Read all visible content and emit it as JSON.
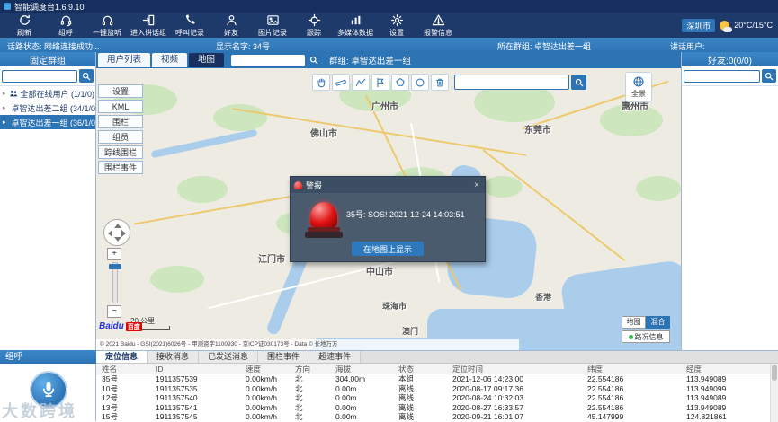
{
  "window": {
    "title": "智能调度台1.6.9.10"
  },
  "toolbar": {
    "buttons": [
      "刷新",
      "组呼",
      "一键监听",
      "进入讲话组",
      "呼叫记录",
      "好友",
      "图片记录",
      "跟踪",
      "多媒体数据",
      "设置",
      "报警信息"
    ],
    "city": "深圳市",
    "temperature": "20°C/15°C"
  },
  "status_bar": {
    "line_status": "话路状态: 网络连接成功...",
    "display_name": "显示名字: 34号",
    "current_group": "所在群组: 卓智达出差一组",
    "talking_user": "讲话用户:"
  },
  "fixed_groups": {
    "title": "固定群组",
    "items": [
      {
        "label": "全部在线用户 (1/1/0)",
        "selected": false
      },
      {
        "label": "卓智达出差二组 (34/1/0)",
        "selected": false
      },
      {
        "label": "卓智达出差一组 (36/1/0)",
        "selected": true
      }
    ]
  },
  "group_call": {
    "title": "组呼"
  },
  "watermark": "大数跨境",
  "center_tabs": {
    "items": [
      "用户列表",
      "视频",
      "地图"
    ],
    "active": "地图",
    "group_info": "群组: 卓智达出差一组"
  },
  "map": {
    "menu": [
      "设置",
      "KML",
      "围栏",
      "组员",
      "踪线围栏",
      "围栏事件"
    ],
    "panorama": "全景",
    "scale": "20 公里",
    "copyright": "© 2021 Baidu - GSI(2021)6026号 - 甲测资字1100930 - 京ICP证030173号 - Data © 长地万方",
    "logo": "Baidu",
    "logo_cn": "百度",
    "layer_map": "地图",
    "layer_hybrid": "混合",
    "traffic": "路况信息",
    "cities": [
      "广州市",
      "惠州市",
      "佛山市",
      "东莞市",
      "江门市",
      "中山市",
      "珠海市",
      "澳门",
      "香港"
    ]
  },
  "alarm_dialog": {
    "title": "警报",
    "message": "35号: SOS!  2021-12-24 14:03:51",
    "action": "在地图上显示"
  },
  "friends": {
    "title": "好友:0(0/0)"
  },
  "bottom": {
    "tabs": [
      "定位信息",
      "接收消息",
      "已发送消息",
      "围栏事件",
      "超速事件"
    ],
    "active_tab": "定位信息",
    "headers": [
      "姓名",
      "ID",
      "速度",
      "方向",
      "海拔",
      "状态",
      "定位时间",
      "纬度",
      "经度"
    ],
    "rows": [
      [
        "35号",
        "1911357539",
        "0.00km/h",
        "北",
        "304.00m",
        "本组",
        "2021-12-06 14:23:00",
        "22.554186",
        "113.949089"
      ],
      [
        "10号",
        "1911357535",
        "0.00km/h",
        "北",
        "0.00m",
        "离线",
        "2020-08-17 09:17:36",
        "22.554186",
        "113.949099"
      ],
      [
        "12号",
        "1911357540",
        "0.00km/h",
        "北",
        "0.00m",
        "离线",
        "2020-08-24 10:32:03",
        "22.554186",
        "113.949089"
      ],
      [
        "13号",
        "1911357541",
        "0.00km/h",
        "北",
        "0.00m",
        "离线",
        "2020-08-27 16:33:57",
        "22.554186",
        "113.949089"
      ],
      [
        "15号",
        "1911357545",
        "0.00km/h",
        "北",
        "0.00m",
        "离线",
        "2020-09-21 16:01:07",
        "45.147999",
        "124.821861"
      ]
    ]
  },
  "icons": {
    "search": "magnifier",
    "refresh": "circular-arrow",
    "alarm": "warning-triangle",
    "mic": "microphone",
    "siren": "red-beacon",
    "weather": "sun-cloud"
  },
  "colors": {
    "accent": "#2d74b5",
    "dark_navy": "#1d3a6b",
    "alert_red": "#e01212"
  }
}
